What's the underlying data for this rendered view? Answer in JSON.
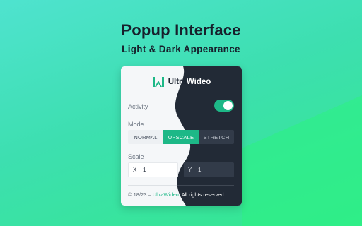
{
  "headline": {
    "title": "Popup Interface",
    "subtitle": "Light & Dark Appearance"
  },
  "brand": {
    "name_part1": "Ultra",
    "name_part2": "Wideo",
    "logo_icon": "ultrawideo-logo-icon"
  },
  "activity": {
    "label": "Activity",
    "enabled": true
  },
  "mode": {
    "label": "Mode",
    "options": [
      "NORMAL",
      "UPSCALE",
      "STRETCH"
    ],
    "selected": "UPSCALE"
  },
  "scale": {
    "label": "Scale",
    "x_label": "X",
    "x_value": "1",
    "y_label": "Y",
    "y_value": "1"
  },
  "footer": {
    "prefix": "© 18/23 – ",
    "link": "UltraWideo",
    "suffix": ". All rights reserved."
  },
  "colors": {
    "accent": "#1db887",
    "dark_panel": "#222a36",
    "light_panel": "#f5f7f9",
    "background_start": "#4fe3cf",
    "background_end": "#33e88e"
  }
}
